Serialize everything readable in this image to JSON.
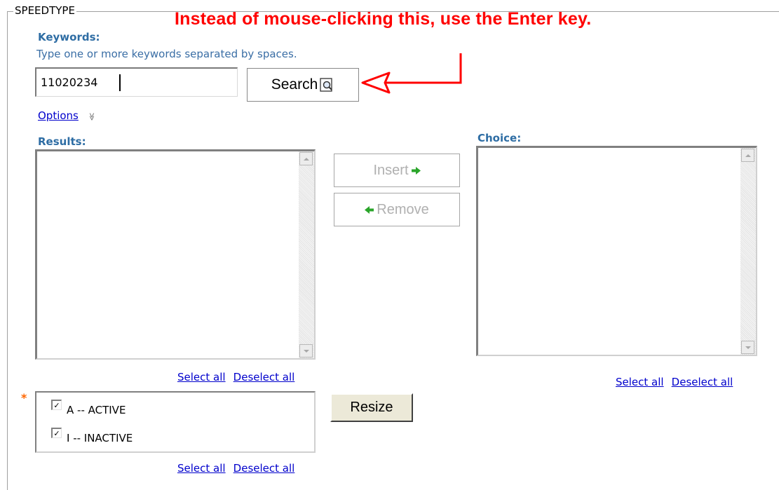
{
  "fieldset": {
    "legend": "SPEEDTYPE"
  },
  "annotation": {
    "text": "Instead of mouse-clicking this, use the Enter key.",
    "color": "#ff0000"
  },
  "keywords": {
    "label": "Keywords:",
    "hint": "Type one or more keywords separated by spaces.",
    "value": "11020234",
    "search_label": "Search"
  },
  "options": {
    "label": "Options",
    "toggle_glyph": "≫"
  },
  "results": {
    "label": "Results:",
    "items": []
  },
  "choice": {
    "label": "Choice:",
    "items": []
  },
  "actions": {
    "insert_label": "Insert",
    "remove_label": "Remove"
  },
  "links": {
    "select_all": "Select all",
    "deselect_all": "Deselect all"
  },
  "status": {
    "required_marker": "*",
    "items": [
      {
        "label": "A -- ACTIVE",
        "checked": true
      },
      {
        "label": "I -- INACTIVE",
        "checked": true
      }
    ]
  },
  "resize": {
    "label": "Resize"
  },
  "colors": {
    "accent": "#2e6da4",
    "link": "#0000cc",
    "arrow_green": "#2aa52a",
    "required": "#ff6600"
  }
}
